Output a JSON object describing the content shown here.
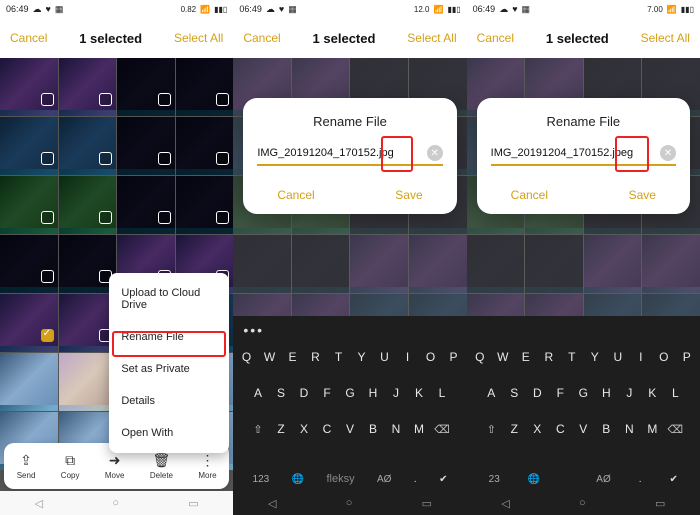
{
  "panes": [
    {
      "status_time": "06:49",
      "net": "0.82",
      "selected_title": "1 selected",
      "cancel": "Cancel",
      "selectall": "Select All"
    },
    {
      "status_time": "06:49",
      "net": "12.0",
      "selected_title": "1 selected",
      "cancel": "Cancel",
      "selectall": "Select All"
    },
    {
      "status_time": "06:49",
      "net": "7.00",
      "selected_title": "1 selected",
      "cancel": "Cancel",
      "selectall": "Select All"
    }
  ],
  "popup": {
    "items": [
      "Upload to Cloud Drive",
      "Rename File",
      "Set as Private",
      "Details",
      "Open With"
    ]
  },
  "toolbar": {
    "send": "Send",
    "copy": "Copy",
    "move": "Move",
    "delete": "Delete",
    "more": "More"
  },
  "modal": {
    "title": "Rename File",
    "value1": "IMG_20191204_170152.jpg",
    "value2": "IMG_20191204_170152.jpeg",
    "cancel": "Cancel",
    "save": "Save"
  },
  "keyboard": {
    "r1": [
      "Q",
      "W",
      "E",
      "R",
      "T",
      "Y",
      "U",
      "I",
      "O",
      "P"
    ],
    "r2": [
      "A",
      "S",
      "D",
      "F",
      "G",
      "H",
      "J",
      "K",
      "L"
    ],
    "r3_shift": "⇧",
    "r3": [
      "Z",
      "X",
      "C",
      "V",
      "B",
      "N",
      "M"
    ],
    "r3_del": "⌫",
    "num": "123",
    "ao": "AØ",
    "fleksy": "fleksy",
    "period": ".",
    "check": "✔"
  },
  "icons": {
    "share": "⇪",
    "copy": "⧉",
    "move": "➜",
    "delete": "🗑",
    "more": "⋮",
    "back": "◁",
    "home": "○",
    "recent": "▭"
  }
}
